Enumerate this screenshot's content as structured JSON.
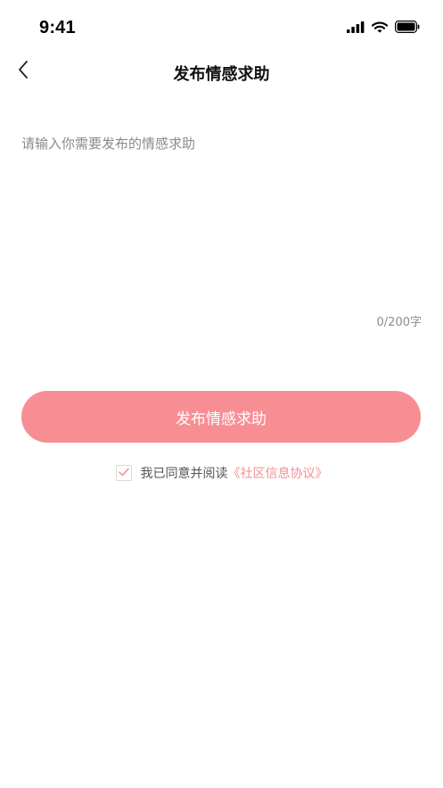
{
  "status_bar": {
    "time": "9:41"
  },
  "header": {
    "title": "发布情感求助"
  },
  "post": {
    "placeholder": "请输入你需要发布的情感求助",
    "value": "",
    "char_count": "0/200字"
  },
  "actions": {
    "submit_label": "发布情感求助"
  },
  "agreement": {
    "checked": true,
    "text": "我已同意并阅读",
    "link": "《社区信息协议》"
  },
  "colors": {
    "accent": "#f78e94",
    "placeholder": "#8a8a8a",
    "muted": "#8c8c8c"
  },
  "icons": {
    "back": "chevron-left-icon",
    "signal": "cellular-signal-icon",
    "wifi": "wifi-icon",
    "battery": "battery-icon",
    "check": "check-icon"
  }
}
